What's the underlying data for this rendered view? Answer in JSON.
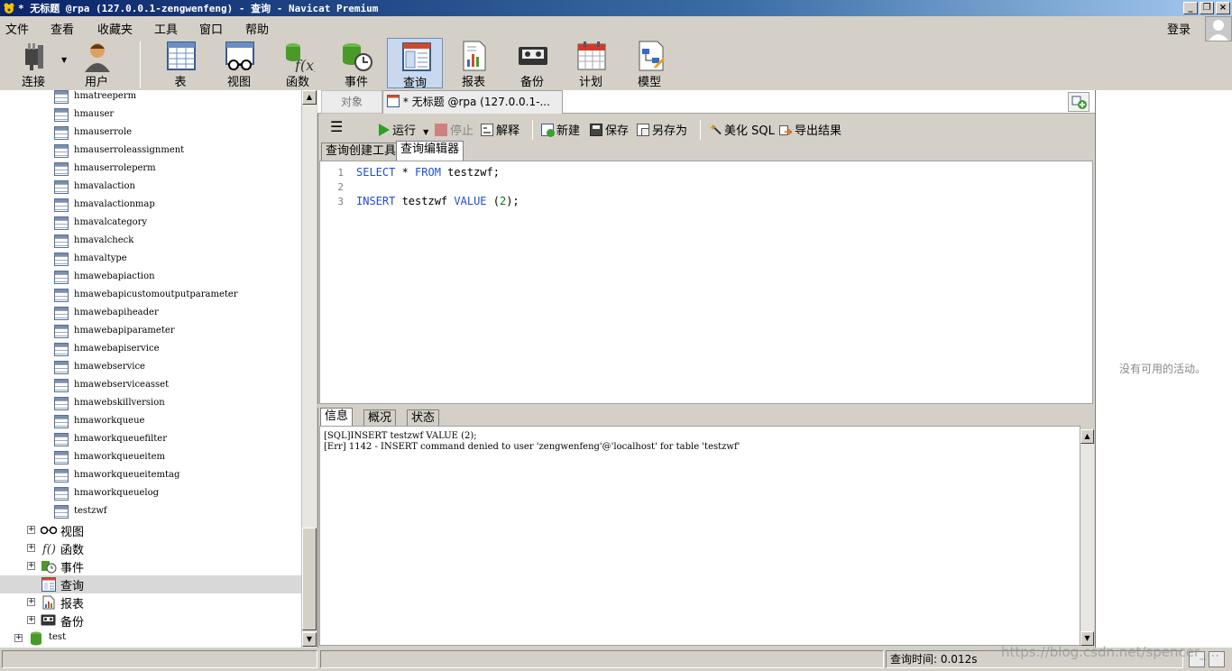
{
  "window": {
    "title": "* 无标题 @rpa (127.0.0.1-zengwenfeng) - 查询 - Navicat Premium",
    "minimize_label": "_",
    "restore_label": "❐",
    "close_label": "×"
  },
  "menubar": {
    "items": [
      "文件",
      "查看",
      "收藏夹",
      "工具",
      "窗口",
      "帮助"
    ],
    "login_label": "登录"
  },
  "toolbar": {
    "items": [
      {
        "label": "连接",
        "icon": "connection-plug-icon"
      },
      {
        "label": "用户",
        "icon": "user-icon"
      },
      {
        "label": "表",
        "icon": "table-icon"
      },
      {
        "label": "视图",
        "icon": "view-glasses-icon"
      },
      {
        "label": "函数",
        "icon": "function-icon"
      },
      {
        "label": "事件",
        "icon": "event-clock-icon"
      },
      {
        "label": "查询",
        "icon": "query-icon"
      },
      {
        "label": "报表",
        "icon": "report-icon"
      },
      {
        "label": "备份",
        "icon": "backup-icon"
      },
      {
        "label": "计划",
        "icon": "schedule-calendar-icon"
      },
      {
        "label": "模型",
        "icon": "model-icon"
      }
    ],
    "active_index": 6
  },
  "tree": {
    "tables": [
      "hmatreeperm",
      "hmauser",
      "hmauserrole",
      "hmauserroleassignment",
      "hmauserroleperm",
      "hmavalaction",
      "hmavalactionmap",
      "hmavalcategory",
      "hmavalcheck",
      "hmavaltype",
      "hmawebapiaction",
      "hmawebapicustomoutputparameter",
      "hmawebapiheader",
      "hmawebapiparameter",
      "hmawebapiservice",
      "hmawebservice",
      "hmawebserviceasset",
      "hmawebskillversion",
      "hmaworkqueue",
      "hmaworkqueuefilter",
      "hmaworkqueueitem",
      "hmaworkqueueitemtag",
      "hmaworkqueuelog",
      "testzwf"
    ],
    "categories": [
      {
        "label": "视图",
        "icon": "view-glasses-icon",
        "expander": "+"
      },
      {
        "label": "函数",
        "icon": "function-icon",
        "expander": "+"
      },
      {
        "label": "事件",
        "icon": "event-clock-icon",
        "expander": "+"
      },
      {
        "label": "查询",
        "icon": "query-icon",
        "expander": "",
        "selected": true
      },
      {
        "label": "报表",
        "icon": "report-icon",
        "expander": "+"
      },
      {
        "label": "备份",
        "icon": "backup-icon",
        "expander": "+"
      }
    ],
    "database": {
      "label": "test",
      "icon": "database-icon",
      "expander": "+"
    }
  },
  "tabs": {
    "objects_label": "对象",
    "query_tab_label": "* 无标题 @rpa (127.0.0.1-..."
  },
  "query_toolbar": {
    "run": "运行",
    "stop": "停止",
    "explain": "解释",
    "new": "新建",
    "save": "保存",
    "save_as": "另存为",
    "beautify": "美化 SQL",
    "export": "导出结果"
  },
  "editor_tabs": {
    "builder": "查询创建工具",
    "editor": "查询编辑器"
  },
  "editor": {
    "line_numbers": [
      "1",
      "2",
      "3"
    ],
    "line1": {
      "kw1": "SELECT",
      "t1": " * ",
      "kw2": "FROM",
      "t2": " testzwf;"
    },
    "line3": {
      "kw1": "INSERT",
      "t1": " testzwf ",
      "kw2": "VALUE",
      "t2": " (",
      "num": "2",
      "t3": ");"
    }
  },
  "result_tabs": [
    "信息",
    "概况",
    "状态"
  ],
  "messages": [
    "[SQL]INSERT testzwf VALUE (2);",
    "[Err] 1142 - INSERT command denied to user 'zengwenfeng'@'localhost' for table 'testzwf'"
  ],
  "right_panel": {
    "empty_text": "没有可用的活动。"
  },
  "statusbar": {
    "query_time": "查询时间: 0.012s"
  },
  "watermark": "https://blog.csdn.net/spencer_..."
}
